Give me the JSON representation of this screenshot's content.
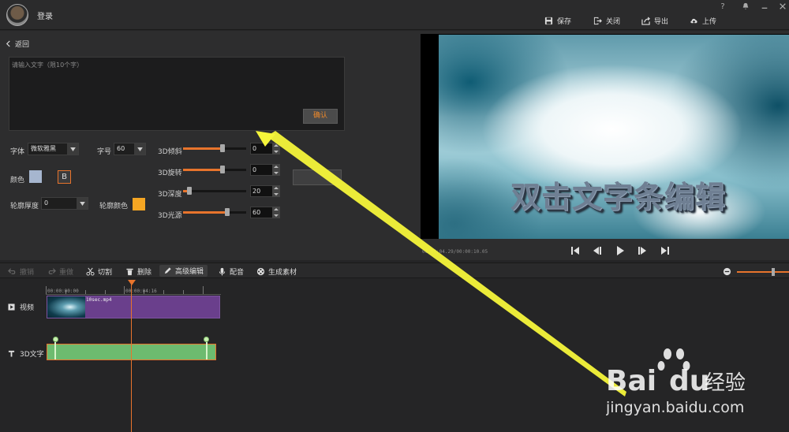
{
  "titlebar": {
    "login": "登录",
    "actions": [
      {
        "label": "保存",
        "icon": "save-icon"
      },
      {
        "label": "关闭",
        "icon": "close-project-icon"
      },
      {
        "label": "导出",
        "icon": "export-icon"
      },
      {
        "label": "上传",
        "icon": "upload-icon"
      }
    ],
    "help": "?"
  },
  "editor": {
    "back_label": "返回",
    "text_placeholder": "请输入文字（限10个字）",
    "confirm_label": "确认",
    "font_label": "字体",
    "font_value": "微软雅黑",
    "size_label": "字号",
    "size_value": "60",
    "color_label": "颜色",
    "color_value": "#a6b6cf",
    "bold_label": "B",
    "outline_width_label": "轮廓厚度",
    "outline_width_value": "0",
    "outline_color_label": "轮廓颜色",
    "outline_color_value": "#f5a623",
    "sliders": [
      {
        "label": "3D倾斜",
        "value": "0",
        "fraction": 0.62
      },
      {
        "label": "3D旋转",
        "value": "0",
        "fraction": 0.62
      },
      {
        "label": "3D深度",
        "value": "20",
        "fraction": 0.1
      },
      {
        "label": "3D光源",
        "value": "60",
        "fraction": 0.7
      }
    ]
  },
  "preview": {
    "title_text": "双击文字条编辑",
    "timecode": "00:00:04.29/00:00:10.05"
  },
  "toolbar": {
    "undo": "撤销",
    "redo": "重做",
    "cut": "切割",
    "delete": "删除",
    "advanced_edit": "高级编辑",
    "dub": "配音",
    "generate": "生成素材"
  },
  "timeline": {
    "ruler": [
      "00:00:00:00",
      "00:00:04:16"
    ],
    "tracks": [
      {
        "label": "视频",
        "clip": "10sec.mp4"
      },
      {
        "label": "3D文字"
      }
    ]
  },
  "watermark": {
    "brand": "Bai",
    "brand2": "du",
    "suffix": "经验",
    "url": "jingyan.baidu.com"
  },
  "colors": {
    "accent": "#e8742c",
    "arrow": "#f5f53a"
  }
}
